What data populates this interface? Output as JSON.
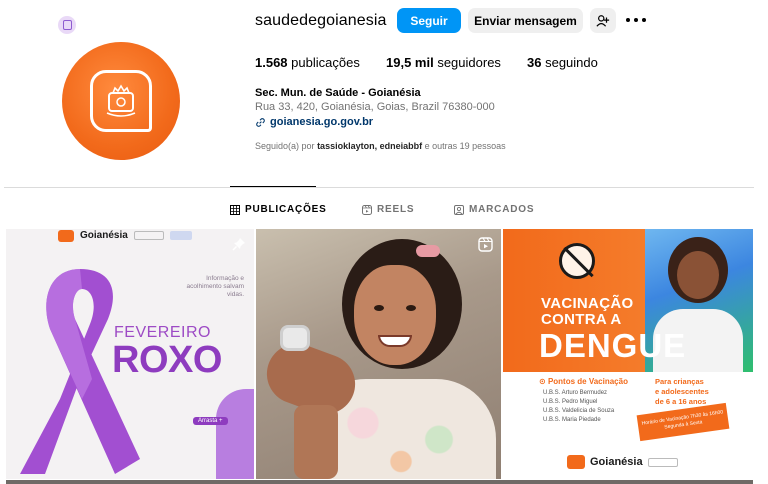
{
  "profile": {
    "username": "saudedegoianesia",
    "follow_label": "Seguir",
    "message_label": "Enviar mensagem",
    "posts_count": "1.568",
    "posts_label": "publicações",
    "followers_count": "19,5 mil",
    "followers_label": "seguidores",
    "following_count": "36",
    "following_label": "seguindo",
    "display_name": "Sec. Mun. de Saúde - Goianésia",
    "address": "Rua 33, 420, Goianésia, Goias, Brazil 76380-000",
    "link": "goianesia.go.gov.br",
    "followed_prefix": "Seguido(a) por",
    "followed_users": "tassioklayton, edneiabbf",
    "followed_suffix": "e outras 19 pessoas"
  },
  "tabs": [
    {
      "label": "PUBLICAÇÕES",
      "active": true
    },
    {
      "label": "REELS",
      "active": false
    },
    {
      "label": "MARCADOS",
      "active": false
    }
  ],
  "posts": {
    "p1": {
      "brand": "Goianésia",
      "tagline": "Informação e acolhimento salvam vidas.",
      "line1": "FEVEREIRO",
      "line2": "ROXO",
      "swipe": "Arrasta +"
    },
    "p3": {
      "line1": "VACINAÇÃO",
      "line2": "CONTRA A",
      "line3": "DENGUE",
      "points_title": "Pontos de Vacinação",
      "points": [
        "U.B.S. Arturo Bermudez",
        "U.B.S. Pedro Miguel",
        "U.B.S. Valdelicia de Souza",
        "U.B.S. Maria Piedade"
      ],
      "kids_l1": "Para crianças",
      "kids_l2": "e adolescentes",
      "kids_l3": "de 6 a 16 anos",
      "hours": "Horário de Vacinação 7h30 às 16h00 Segunda à Sexta",
      "brand": "Goianésia"
    }
  },
  "colors": {
    "accent": "#0095f6",
    "brand_orange": "#f26a1b",
    "purple": "#8e3cbf"
  }
}
